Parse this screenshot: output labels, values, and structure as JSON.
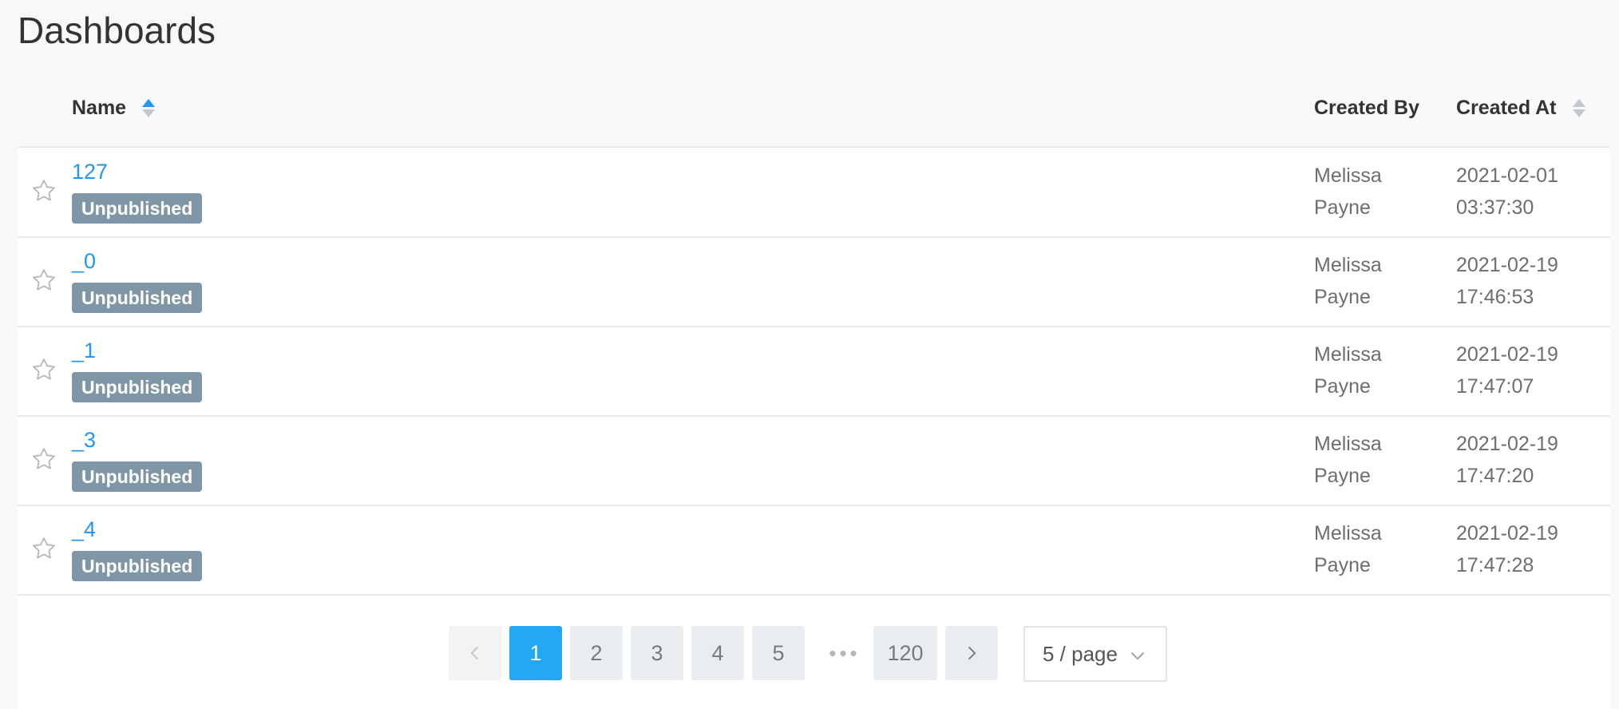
{
  "page": {
    "title": "Dashboards"
  },
  "table": {
    "columns": {
      "name": "Name",
      "created_by": "Created By",
      "created_at": "Created At"
    },
    "rows": [
      {
        "name": "127",
        "status": "Unpublished",
        "created_by_first": "Melissa",
        "created_by_last": "Payne",
        "date": "2021-02-01",
        "time": "03:37:30"
      },
      {
        "name": "_0",
        "status": "Unpublished",
        "created_by_first": "Melissa",
        "created_by_last": "Payne",
        "date": "2021-02-19",
        "time": "17:46:53"
      },
      {
        "name": "_1",
        "status": "Unpublished",
        "created_by_first": "Melissa",
        "created_by_last": "Payne",
        "date": "2021-02-19",
        "time": "17:47:07"
      },
      {
        "name": "_3",
        "status": "Unpublished",
        "created_by_first": "Melissa",
        "created_by_last": "Payne",
        "date": "2021-02-19",
        "time": "17:47:20"
      },
      {
        "name": "_4",
        "status": "Unpublished",
        "created_by_first": "Melissa",
        "created_by_last": "Payne",
        "date": "2021-02-19",
        "time": "17:47:28"
      }
    ]
  },
  "pagination": {
    "pages": [
      "1",
      "2",
      "3",
      "4",
      "5"
    ],
    "ellipsis": "•••",
    "last_page": "120",
    "current": "1",
    "page_size": "5 / page"
  },
  "colors": {
    "accent": "#24a8f3",
    "link": "#2196f3",
    "badge": "#7f96a7"
  },
  "icons": {
    "star": "star-outline-icon",
    "prev": "chevron-left-icon",
    "next": "chevron-right-icon",
    "dropdown": "chevron-down-icon"
  }
}
